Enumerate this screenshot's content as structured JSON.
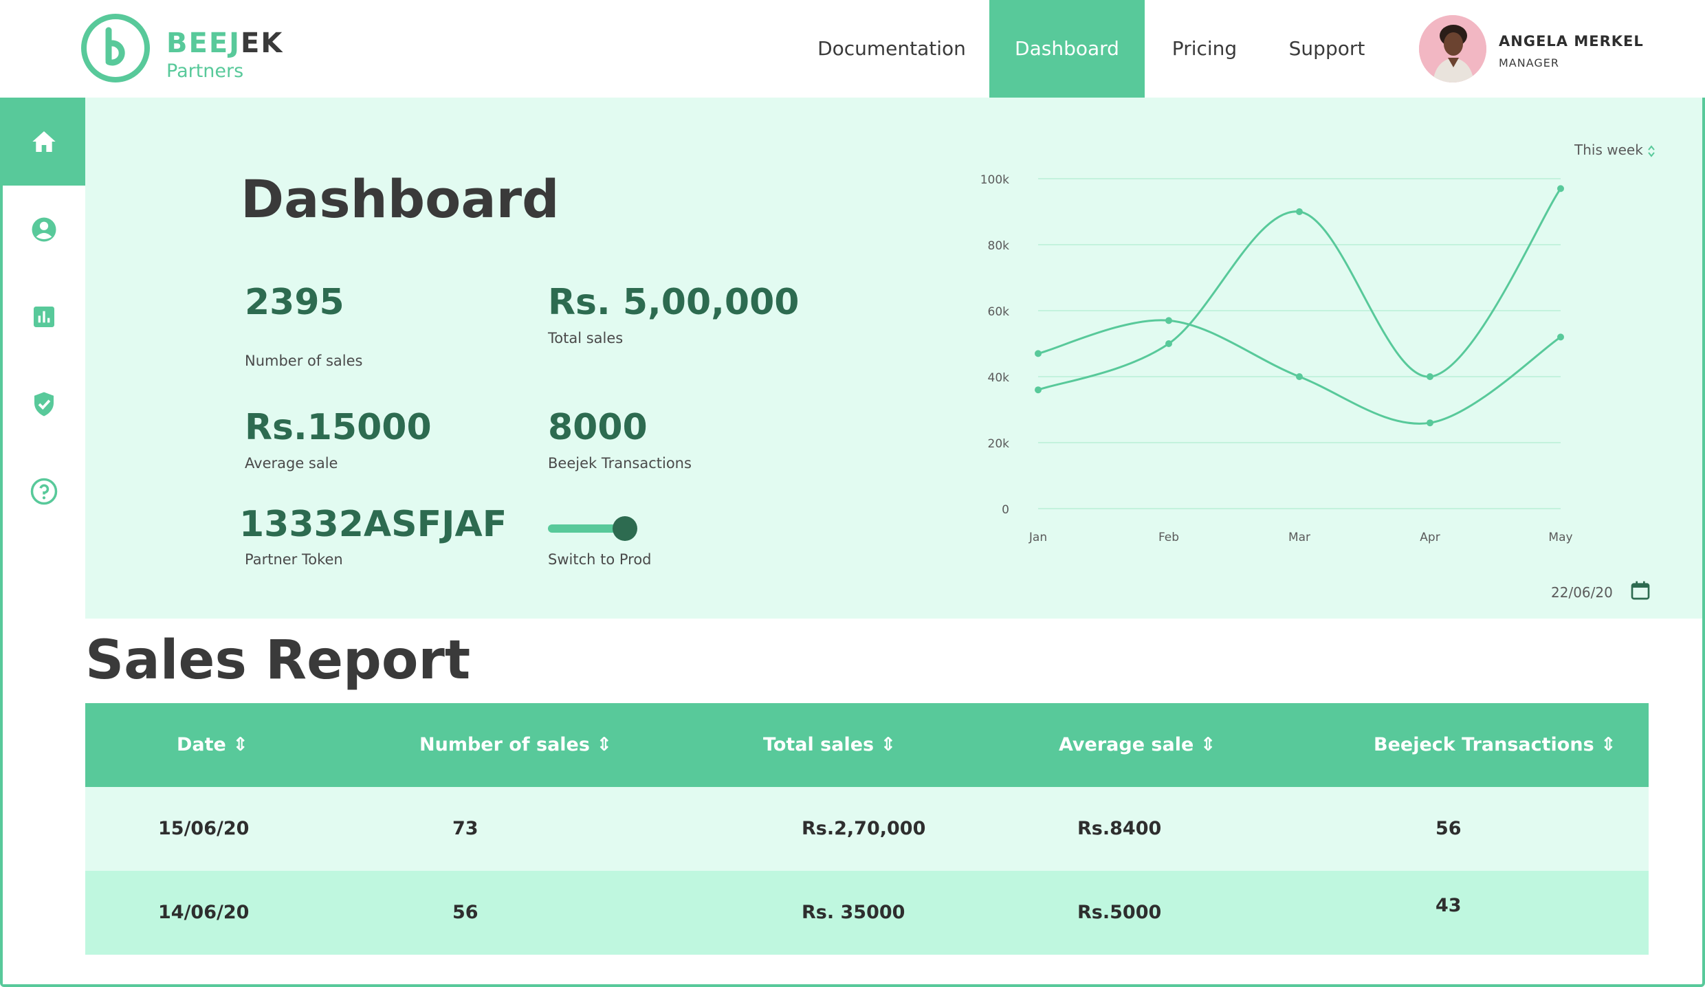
{
  "brand": {
    "name_part1": "BEEJ",
    "name_part2": "EK",
    "subtitle": "Partners",
    "accent": "#58c99a"
  },
  "nav": {
    "items": [
      {
        "label": "Documentation",
        "active": false
      },
      {
        "label": "Dashboard",
        "active": true
      },
      {
        "label": "Pricing",
        "active": false
      },
      {
        "label": "Support",
        "active": false
      }
    ]
  },
  "user": {
    "name": "ANGELA MERKEL",
    "role": "MANAGER"
  },
  "sidebar": {
    "items": [
      {
        "icon": "home-icon",
        "active": true
      },
      {
        "icon": "user-icon",
        "active": false
      },
      {
        "icon": "bar-chart-icon",
        "active": false
      },
      {
        "icon": "shield-check-icon",
        "active": false
      },
      {
        "icon": "help-icon",
        "active": false
      }
    ]
  },
  "dashboard": {
    "title": "Dashboard",
    "stats": {
      "num_sales": {
        "value": "2395",
        "label": "Number of sales"
      },
      "total_sales": {
        "value": "Rs. 5,00,000",
        "label": "Total sales"
      },
      "avg_sale": {
        "value": "Rs.15000",
        "label": "Average sale"
      },
      "transactions": {
        "value": "8000",
        "label": "Beejek Transactions"
      },
      "token": {
        "value": "13332ASFJAF",
        "label": "Partner Token"
      }
    },
    "toggle": {
      "label": "Switch to Prod",
      "on": true
    },
    "range_select": "This week",
    "date": "22/06/20"
  },
  "chart_data": {
    "type": "line",
    "categories": [
      "Jan",
      "Feb",
      "Mar",
      "Apr",
      "May"
    ],
    "series": [
      {
        "values": [
          47000,
          57000,
          40000,
          26000,
          52000
        ]
      },
      {
        "values": [
          36000,
          50000,
          90000,
          40000,
          97000
        ]
      }
    ],
    "yticks": [
      "100k",
      "80k",
      "60k",
      "40k",
      "20k",
      "0"
    ],
    "ylim": [
      0,
      100000
    ],
    "grid": true,
    "line_color": "#58c99a",
    "grid_color": "#c3f2dd"
  },
  "sales_report": {
    "title": "Sales Report",
    "columns": [
      "Date",
      "Number of sales",
      "Total sales",
      "Average sale",
      "Beejeck Transactions"
    ],
    "rows": [
      [
        "15/06/20",
        "73",
        "Rs.2,70,000",
        "Rs.8400",
        "56"
      ],
      [
        "14/06/20",
        "56",
        "Rs. 35000",
        "Rs.5000",
        "43"
      ]
    ]
  }
}
